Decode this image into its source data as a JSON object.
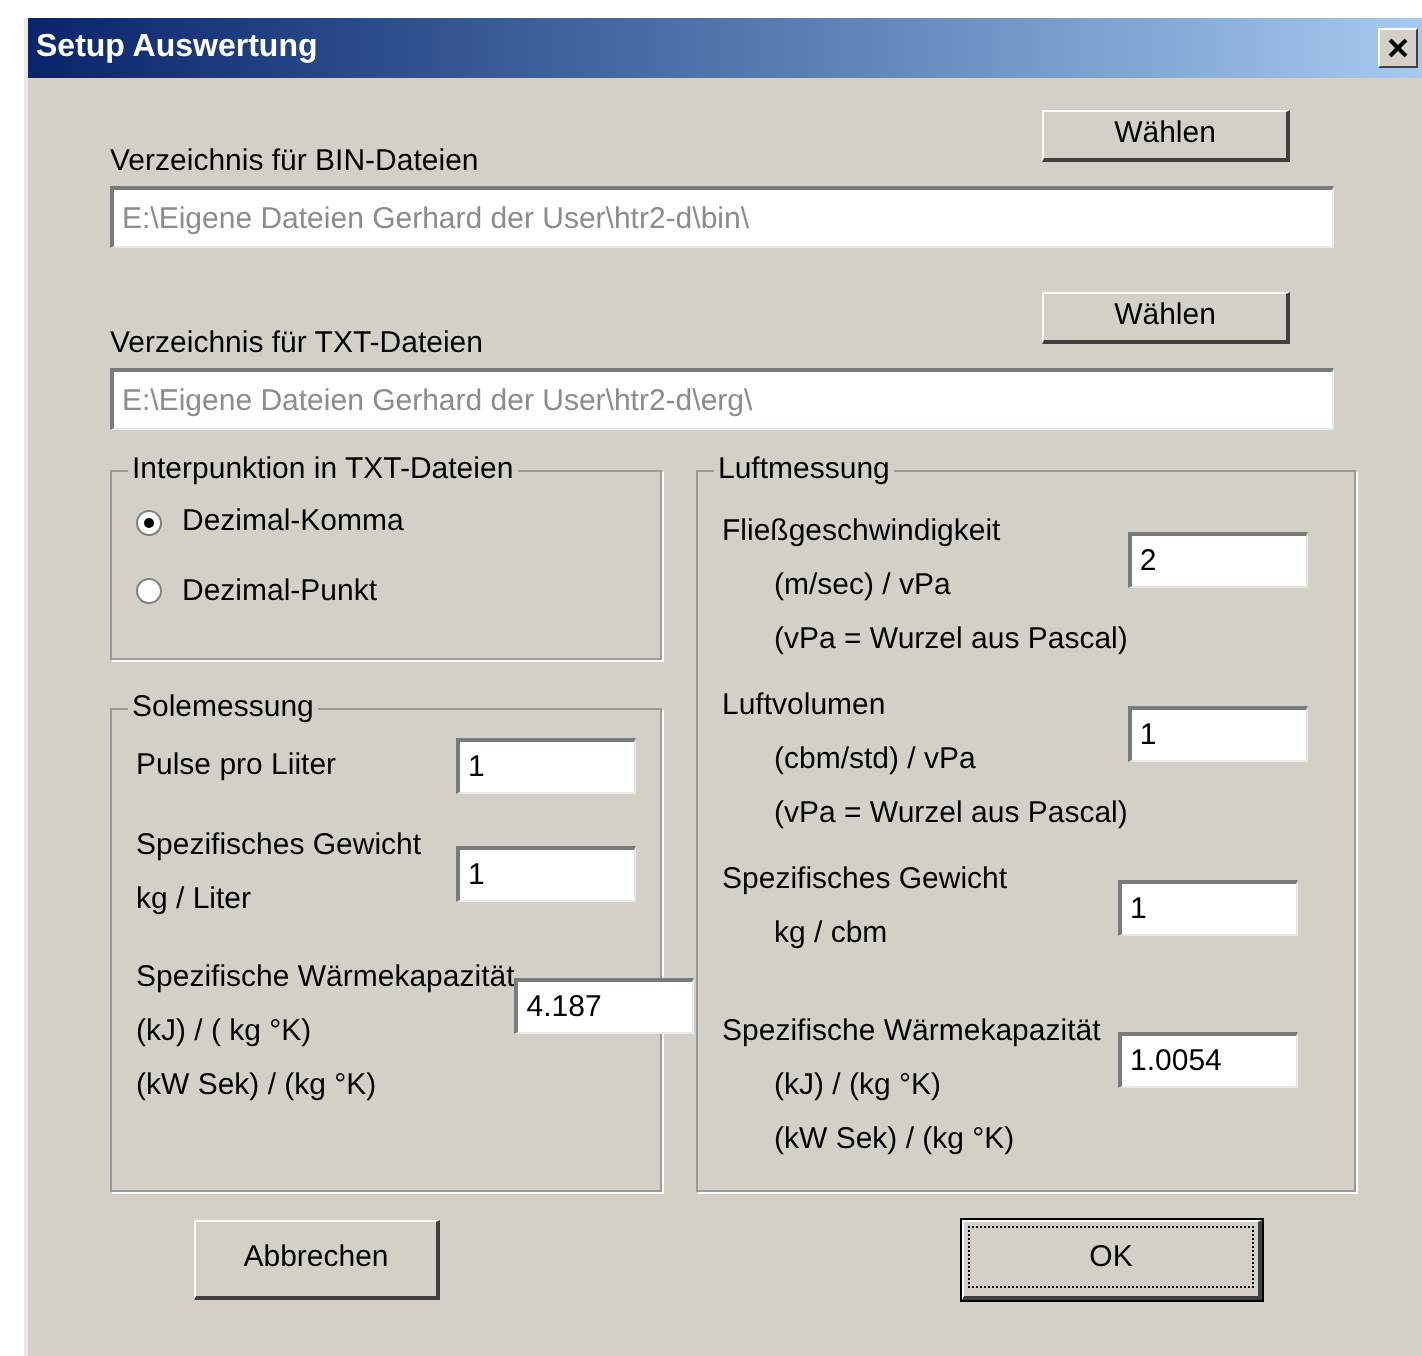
{
  "window": {
    "title": "Setup Auswertung"
  },
  "directories": [
    {
      "label": "Verzeichnis für BIN-Dateien",
      "button": "Wählen",
      "value": "E:\\Eigene Dateien Gerhard der User\\htr2-d\\bin\\",
      "disabled": true
    },
    {
      "label": "Verzeichnis für TXT-Dateien",
      "button": "Wählen",
      "value": "E:\\Eigene Dateien Gerhard der User\\htr2-d\\erg\\",
      "disabled": true
    }
  ],
  "punctuation": {
    "title": "Interpunktion in TXT-Dateien",
    "options": [
      {
        "label": "Dezimal-Komma",
        "selected": true
      },
      {
        "label": "Dezimal-Punkt",
        "selected": false
      }
    ]
  },
  "sole": {
    "title": "Solemessung",
    "indent_sublines": false,
    "items": [
      {
        "lines": [
          "Pulse pro Liiter"
        ],
        "value": "1"
      },
      {
        "lines": [
          "Spezifisches Gewicht",
          "kg / Liter"
        ],
        "value": "1"
      },
      {
        "lines": [
          "Spezifische Wärmekapazität",
          "(kJ) / ( kg °K)",
          "(kW Sek) / (kg °K)"
        ],
        "value": "4.187"
      }
    ]
  },
  "air": {
    "title": "Luftmessung",
    "indent_sublines": true,
    "items": [
      {
        "lines": [
          "Fließgeschwindigkeit",
          "(m/sec) / vPa",
          "(vPa = Wurzel aus Pascal)"
        ],
        "value": "2"
      },
      {
        "lines": [
          "Luftvolumen",
          "(cbm/std) / vPa",
          "(vPa = Wurzel aus Pascal)"
        ],
        "value": "1"
      },
      {
        "lines": [
          "Spezifisches Gewicht",
          "kg / cbm"
        ],
        "value": "1"
      },
      {
        "lines": [
          "Spezifische Wärmekapazität",
          "(kJ) / (kg °K)",
          "(kW Sek) / (kg °K)"
        ],
        "value": "1.0054"
      }
    ]
  },
  "buttons": [
    {
      "label": "Abbrechen",
      "default": false
    },
    {
      "label": "OK",
      "default": true
    }
  ]
}
